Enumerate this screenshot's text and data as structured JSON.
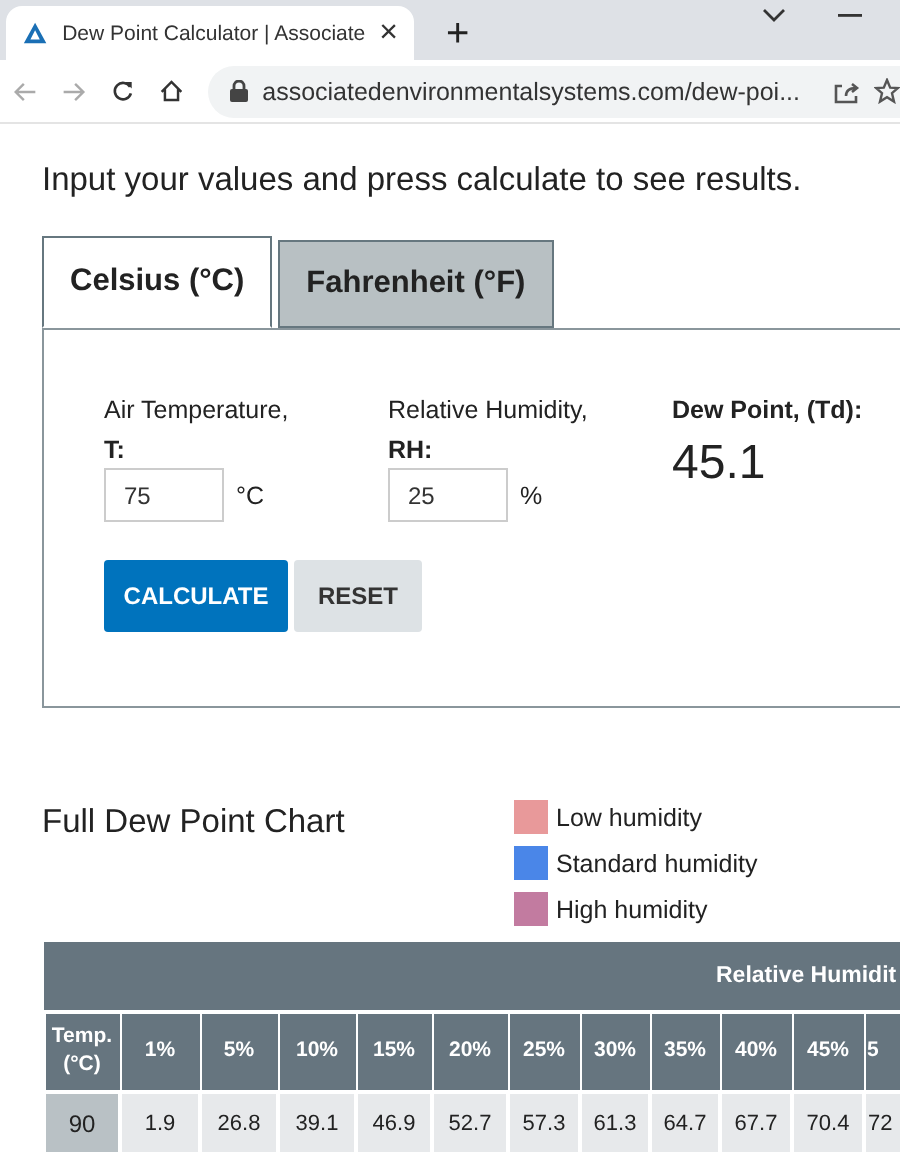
{
  "browser": {
    "tab_title": "Dew Point Calculator | Associate",
    "tab_close": "×",
    "new_tab": "+",
    "url": "associatedenvironmentalsystems.com/dew-poi..."
  },
  "intro": "Input your values and press calculate to see results.",
  "unit_tabs": [
    {
      "label": "Celsius (°C)",
      "selected": true
    },
    {
      "label": "Fahrenheit (°F)",
      "selected": false
    }
  ],
  "inputs": [
    {
      "label": "Air Temperature,",
      "symbol": "T:",
      "value": "75",
      "unit": "°C"
    },
    {
      "label": "Relative Humidity,",
      "symbol": "RH:",
      "value": "25",
      "unit": "%"
    }
  ],
  "result": {
    "label": "Dew Point, (Td):",
    "value": "45.1"
  },
  "buttons": [
    {
      "label": "CALCULATE",
      "kind": "primary"
    },
    {
      "label": "RESET",
      "kind": "secondary"
    }
  ],
  "chart_title": "Full Dew Point Chart",
  "legend": [
    {
      "label": "Low humidity",
      "color": "#e8999a"
    },
    {
      "label": "Standard humidity",
      "color": "#4a86e8"
    },
    {
      "label": "High humidity",
      "color": "#c27ba0"
    }
  ],
  "table": {
    "group_header": "Relative Humidit",
    "temp_header": "Temp. (°C)",
    "columns": [
      "1%",
      "5%",
      "10%",
      "15%",
      "20%",
      "25%",
      "30%",
      "35%",
      "40%",
      "45%",
      "5"
    ],
    "rows": [
      {
        "temp": "90",
        "values": [
          "1.9",
          "26.8",
          "39.1",
          "46.9",
          "52.7",
          "57.3",
          "61.3",
          "64.7",
          "67.7",
          "70.4",
          "72"
        ]
      }
    ]
  }
}
